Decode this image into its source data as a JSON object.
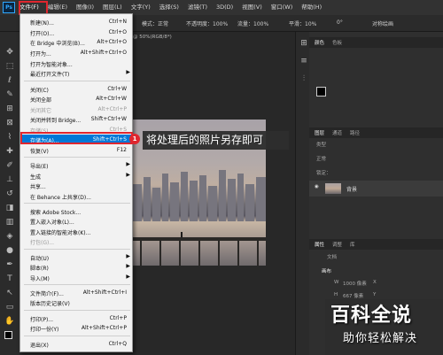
{
  "app": {
    "logo": "Ps"
  },
  "menubar": {
    "items": [
      "文件(F)",
      "编辑(E)",
      "图像(I)",
      "图层(L)",
      "文字(Y)",
      "选择(S)",
      "滤镜(T)",
      "3D(D)",
      "视图(V)",
      "窗口(W)",
      "帮助(H)"
    ]
  },
  "optionsbar": {
    "mode": "模式：正常",
    "opacity": "不透明度：100%",
    "flow": "流量：100%",
    "smooth": "平滑：10%",
    "angle": "0°",
    "symmetry": "对称绘画"
  },
  "document": {
    "tab": "@ 50%(RGB/8*)"
  },
  "file_menu": {
    "items": [
      {
        "label": "新建(N)...",
        "shortcut": "Ctrl+N"
      },
      {
        "label": "打开(O)...",
        "shortcut": "Ctrl+O"
      },
      {
        "label": "在 Bridge 中浏览(B)...",
        "shortcut": "Alt+Ctrl+O"
      },
      {
        "label": "打开为...",
        "shortcut": "Alt+Shift+Ctrl+O"
      },
      {
        "label": "打开为智能对象...",
        "shortcut": ""
      },
      {
        "label": "最近打开文件(T)",
        "shortcut": ""
      },
      {
        "label": "关闭(C)",
        "shortcut": "Ctrl+W"
      },
      {
        "label": "关闭全部",
        "shortcut": "Alt+Ctrl+W"
      },
      {
        "label": "关闭其它",
        "shortcut": "Alt+Ctrl+P"
      },
      {
        "label": "关闭并转到 Bridge...",
        "shortcut": "Shift+Ctrl+W"
      },
      {
        "label": "存储(S)",
        "shortcut": "Ctrl+S"
      },
      {
        "label": "存储为(A)...",
        "shortcut": "Shift+Ctrl+S"
      },
      {
        "label": "恢复(V)",
        "shortcut": "F12"
      },
      {
        "label": "导出(E)",
        "shortcut": ""
      },
      {
        "label": "生成",
        "shortcut": ""
      },
      {
        "label": "共享...",
        "shortcut": ""
      },
      {
        "label": "在 Behance 上共享(D)...",
        "shortcut": ""
      },
      {
        "label": "搜索 Adobe Stock...",
        "shortcut": ""
      },
      {
        "label": "置入嵌入对象(L)...",
        "shortcut": ""
      },
      {
        "label": "置入链接的智能对象(K)...",
        "shortcut": ""
      },
      {
        "label": "打包(G)...",
        "shortcut": ""
      },
      {
        "label": "自动(U)",
        "shortcut": ""
      },
      {
        "label": "脚本(R)",
        "shortcut": ""
      },
      {
        "label": "导入(M)",
        "shortcut": ""
      },
      {
        "label": "文件简介(F)...",
        "shortcut": "Alt+Shift+Ctrl+I"
      },
      {
        "label": "版本历史记录(V)",
        "shortcut": ""
      },
      {
        "label": "打印(P)...",
        "shortcut": "Ctrl+P"
      },
      {
        "label": "打印一份(Y)",
        "shortcut": "Alt+Shift+Ctrl+P"
      },
      {
        "label": "退出(X)",
        "shortcut": "Ctrl+Q"
      }
    ]
  },
  "callout": {
    "badge": "1",
    "text": "将处理后的照片另存即可"
  },
  "panels": {
    "color_tabs": [
      "颜色",
      "色板"
    ],
    "layer_tabs": [
      "图层",
      "通道",
      "路径"
    ],
    "layer_kind": "类型",
    "layer_mode": "正常",
    "layer_lock": "锁定：",
    "layer_name": "背景",
    "props_tabs": [
      "属性",
      "调整",
      "库"
    ],
    "doc_label": "文档",
    "canvas_label": "画布",
    "w_label": "W",
    "w_value": "1000 像素",
    "h_label": "H",
    "h_value": "667 像素",
    "x_label": "X",
    "y_label": "Y"
  },
  "watermark": {
    "big": "百科全说",
    "small": "助你轻松解决"
  }
}
